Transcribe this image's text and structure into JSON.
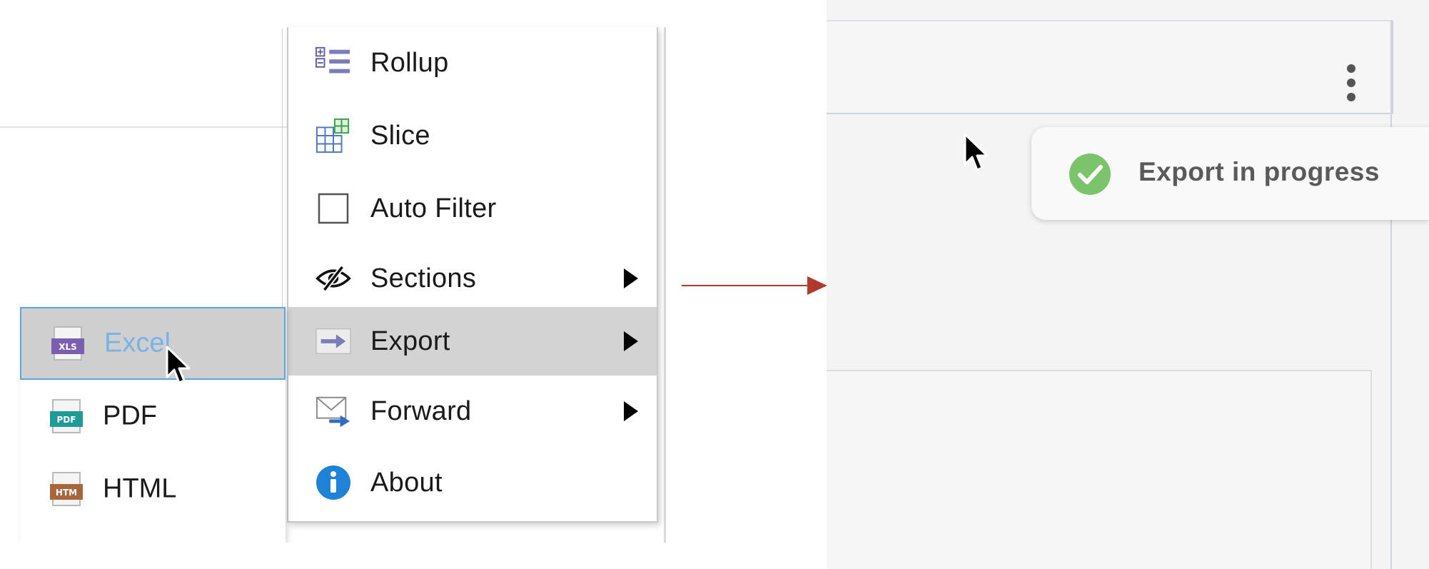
{
  "context_menu": {
    "items": [
      {
        "label": "Rollup",
        "icon": "rollup-icon"
      },
      {
        "label": "Slice",
        "icon": "slice-icon"
      },
      {
        "label": "Auto Filter",
        "icon": "checkbox-icon"
      },
      {
        "label": "Sections",
        "icon": "eye-slash-icon",
        "has_submenu": true
      },
      {
        "label": "Export",
        "icon": "export-arrow-icon",
        "has_submenu": true,
        "highlighted": true
      },
      {
        "label": "Forward",
        "icon": "mail-forward-icon",
        "has_submenu": true
      },
      {
        "label": "About",
        "icon": "info-icon"
      }
    ]
  },
  "export_submenu": {
    "items": [
      {
        "label": "Excel",
        "icon": "xls-file-icon",
        "selected": true
      },
      {
        "label": "PDF",
        "icon": "pdf-file-icon"
      },
      {
        "label": "HTML",
        "icon": "html-file-icon"
      }
    ]
  },
  "toast": {
    "message": "Export in progress",
    "icon": "check-circle-icon",
    "status_color": "#7cc46b"
  },
  "colors": {
    "highlight": "#d3d3d3",
    "selection_border": "#5aa7e8",
    "selected_text": "#7ab2e6",
    "transition_arrow": "#b03a2e"
  }
}
